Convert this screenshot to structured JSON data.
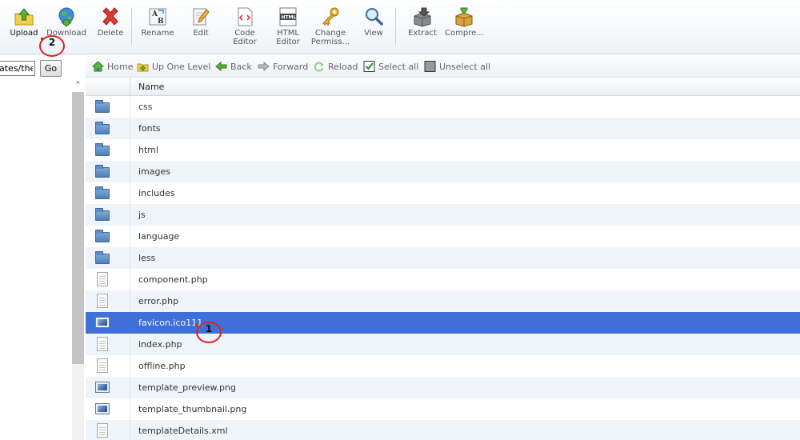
{
  "toolbar": {
    "buttons": [
      {
        "id": "upload",
        "label": "Upload",
        "icon": "upload-icon"
      },
      {
        "id": "download",
        "label": "Download",
        "icon": "download-icon"
      },
      {
        "id": "delete",
        "label": "Delete",
        "icon": "delete-icon"
      },
      {
        "id": "rename",
        "label": "Rename",
        "icon": "rename-icon"
      },
      {
        "id": "edit",
        "label": "Edit",
        "icon": "edit-icon"
      },
      {
        "id": "code-editor",
        "label_line1": "Code",
        "label_line2": "Editor",
        "icon": "code-editor-icon"
      },
      {
        "id": "html-editor",
        "label_line1": "HTML",
        "label_line2": "Editor",
        "icon": "html-editor-icon"
      },
      {
        "id": "change-permissions",
        "label_line1": "Change",
        "label_line2": "Permiss...",
        "icon": "key-icon"
      },
      {
        "id": "view",
        "label": "View",
        "icon": "magnifier-icon"
      },
      {
        "id": "extract",
        "label": "Extract",
        "icon": "extract-icon"
      },
      {
        "id": "compress",
        "label": "Compre...",
        "icon": "compress-icon"
      }
    ],
    "html_icon_text": "HTML",
    "rename_icon_text": "AB"
  },
  "left_panel": {
    "path_value": "ates/the",
    "go_label": "Go"
  },
  "navbar": {
    "home": "Home",
    "up_one_level": "Up One Level",
    "back": "Back",
    "forward": "Forward",
    "reload": "Reload",
    "select_all": "Select all",
    "unselect_all": "Unselect all"
  },
  "table": {
    "header_name": "Name",
    "rows": [
      {
        "name": "css",
        "type": "folder"
      },
      {
        "name": "fonts",
        "type": "folder"
      },
      {
        "name": "html",
        "type": "folder"
      },
      {
        "name": "images",
        "type": "folder"
      },
      {
        "name": "includes",
        "type": "folder"
      },
      {
        "name": "js",
        "type": "folder"
      },
      {
        "name": "language",
        "type": "folder"
      },
      {
        "name": "less",
        "type": "folder"
      },
      {
        "name": "component.php",
        "type": "document"
      },
      {
        "name": "error.php",
        "type": "document"
      },
      {
        "name": "favicon.ico111",
        "type": "image",
        "selected": true
      },
      {
        "name": "index.php",
        "type": "document"
      },
      {
        "name": "offline.php",
        "type": "document"
      },
      {
        "name": "template_preview.png",
        "type": "image"
      },
      {
        "name": "template_thumbnail.png",
        "type": "image"
      },
      {
        "name": "templateDetails.xml",
        "type": "document"
      }
    ]
  },
  "callouts": {
    "one": "1",
    "two": "2"
  },
  "colors": {
    "selected_row": "#3f6fd8",
    "alt_row": "#eef4fa",
    "callout_ring": "#dd2222"
  }
}
